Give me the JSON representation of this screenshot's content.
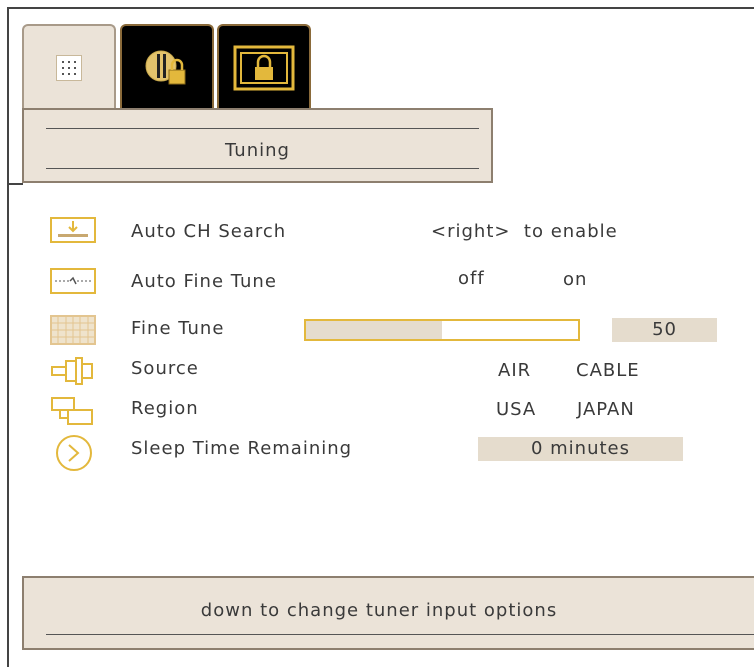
{
  "menu": {
    "title": "Tuning"
  },
  "tabs": [
    {
      "icon": "tuning-grid-icon",
      "selected": true
    },
    {
      "icon": "parental-lock-icon",
      "selected": false
    },
    {
      "icon": "screen-lock-icon",
      "selected": false
    }
  ],
  "rows": {
    "auto_ch_search": {
      "label": "Auto CH Search",
      "hint": "<right>  to enable",
      "icon": "auto-search-icon"
    },
    "auto_fine_tune": {
      "label": "Auto Fine Tune",
      "off": "off",
      "on": "on",
      "icon": "fine-tune-wave-icon"
    },
    "fine_tune": {
      "label": "Fine Tune",
      "value": "50",
      "level_fraction": 0.5,
      "icon": "grid-icon"
    },
    "source": {
      "label": "Source",
      "opt1": "AIR",
      "opt2": "CABLE",
      "icon": "connector-icon"
    },
    "region": {
      "label": "Region",
      "opt1": "USA",
      "opt2": "JAPAN",
      "icon": "region-icon"
    },
    "sleep": {
      "label": "Sleep Time Remaining",
      "value": "0 minutes",
      "icon": "clock-icon"
    }
  },
  "footer": {
    "hint": "down to change tuner input options"
  },
  "colors": {
    "panel": "#ebe3d8",
    "accent": "#e3b83c",
    "tab_dark": "#000000"
  }
}
